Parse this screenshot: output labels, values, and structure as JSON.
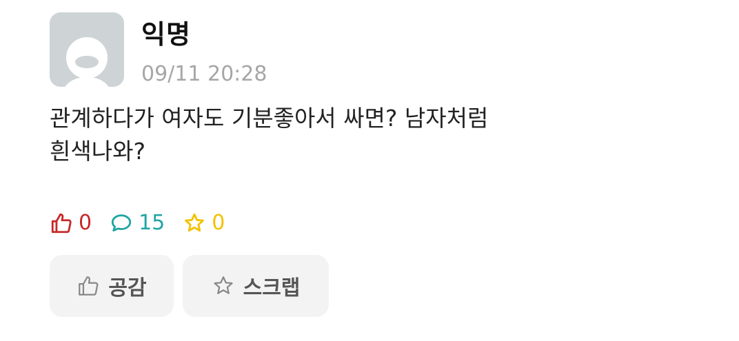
{
  "post": {
    "author": "익명",
    "timestamp": "09/11 20:28",
    "content_lines": [
      "관계하다가 여자도 기분좋아서 싸면? 남자처럼",
      "흰색나와?"
    ],
    "avatar_icon": "default-avatar-icon"
  },
  "stats": {
    "likes": "0",
    "comments": "15",
    "scraps": "0",
    "like_icon": "thumbs-up-icon",
    "comment_icon": "speech-bubble-icon",
    "scrap_icon": "star-icon",
    "colors": {
      "like": "#c62828",
      "comment": "#1fa5a3",
      "scrap": "#f2c200"
    }
  },
  "actions": {
    "like_label": "공감",
    "scrap_label": "스크랩"
  }
}
